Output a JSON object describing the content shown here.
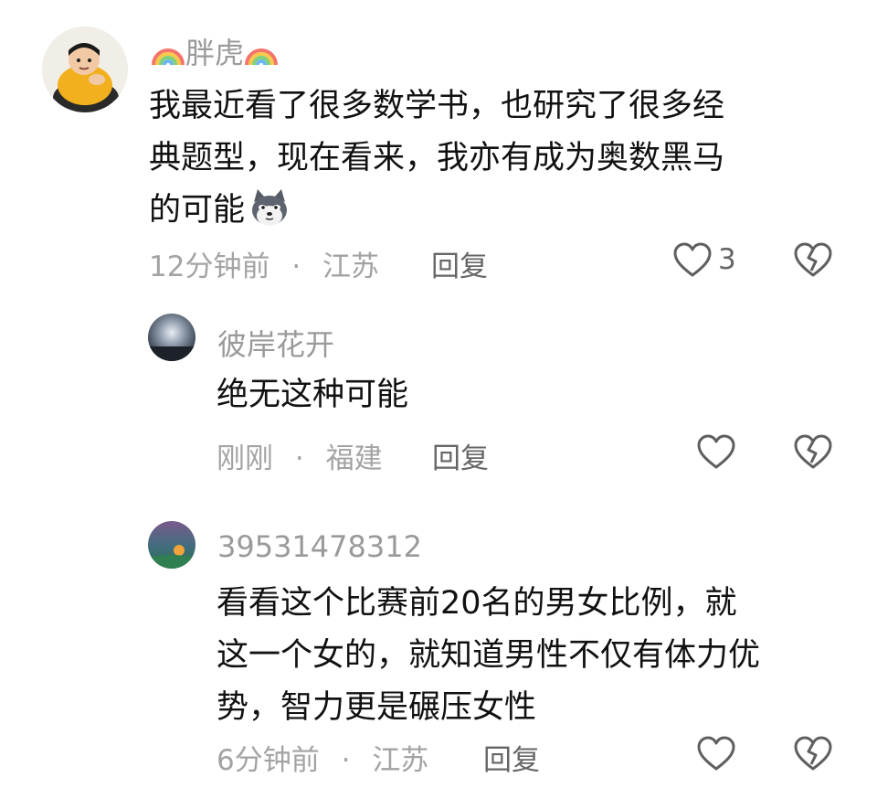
{
  "comments": [
    {
      "name": "胖虎",
      "lines": [
        "我最近看了很多数学书，也研究了很多经",
        "典题型，现在看来，我亦有成为奥数黑马",
        "的可能"
      ],
      "emoji_icon": "shiba-dog-emoji",
      "time": "12分钟前",
      "dot": "·",
      "location": "江苏",
      "reply_label": "回复",
      "like_count": "3"
    },
    {
      "name": "彼岸花开",
      "lines": [
        "绝无这种可能"
      ],
      "time": "刚刚",
      "dot": "·",
      "location": "福建",
      "reply_label": "回复"
    },
    {
      "name": "39531478312",
      "lines": [
        "看看这个比赛前20名的男女比例，就",
        "这一个女的，就知道男性不仅有体力优",
        "势，智力更是碾压女性"
      ],
      "time": "6分钟前",
      "dot": "·",
      "location": "江苏",
      "reply_label": "回复"
    }
  ],
  "colors": {
    "meta": "#a3a3a3",
    "icon": "#5f5f5f",
    "text": "#111111"
  }
}
